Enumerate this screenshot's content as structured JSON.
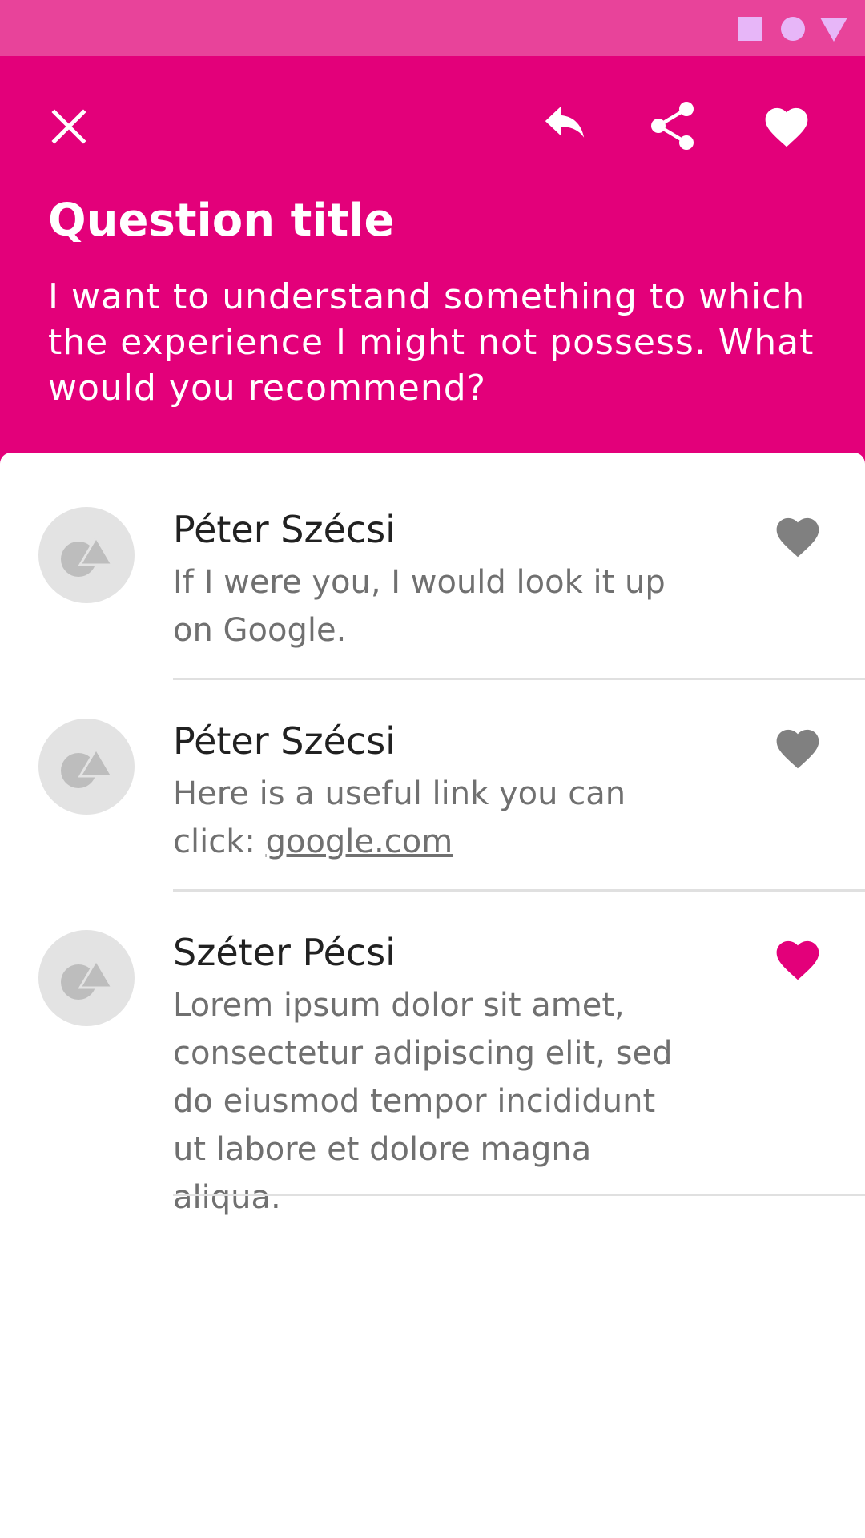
{
  "status_bar": {
    "icons": [
      "square-icon",
      "circle-icon",
      "triangle-icon"
    ],
    "color": "#e7b6f8",
    "background": "#e8439a"
  },
  "header": {
    "background": "#e3007a",
    "actions": [
      "close-icon",
      "reply-icon",
      "share-icon",
      "heart-icon"
    ],
    "title": "Question title",
    "question": "I want to understand something to which the experience I might not possess. What would you recommend?"
  },
  "answers": [
    {
      "name": "Péter Szécsi",
      "text": "If I were you, I would look it up on Google.",
      "liked": false
    },
    {
      "name": "Péter Szécsi",
      "text_prefix": "Here is a useful link you can click: ",
      "link": "google.com",
      "liked": false
    },
    {
      "name": "Széter Pécsi",
      "text": "Lorem ipsum dolor sit amet, consectetur adipiscing elit, sed do eiusmod tempor incididunt ut labore et dolore magna aliqua.",
      "liked": true
    }
  ],
  "colors": {
    "accent": "#e3007a",
    "like_inactive": "#808080",
    "like_active": "#e3007a"
  }
}
